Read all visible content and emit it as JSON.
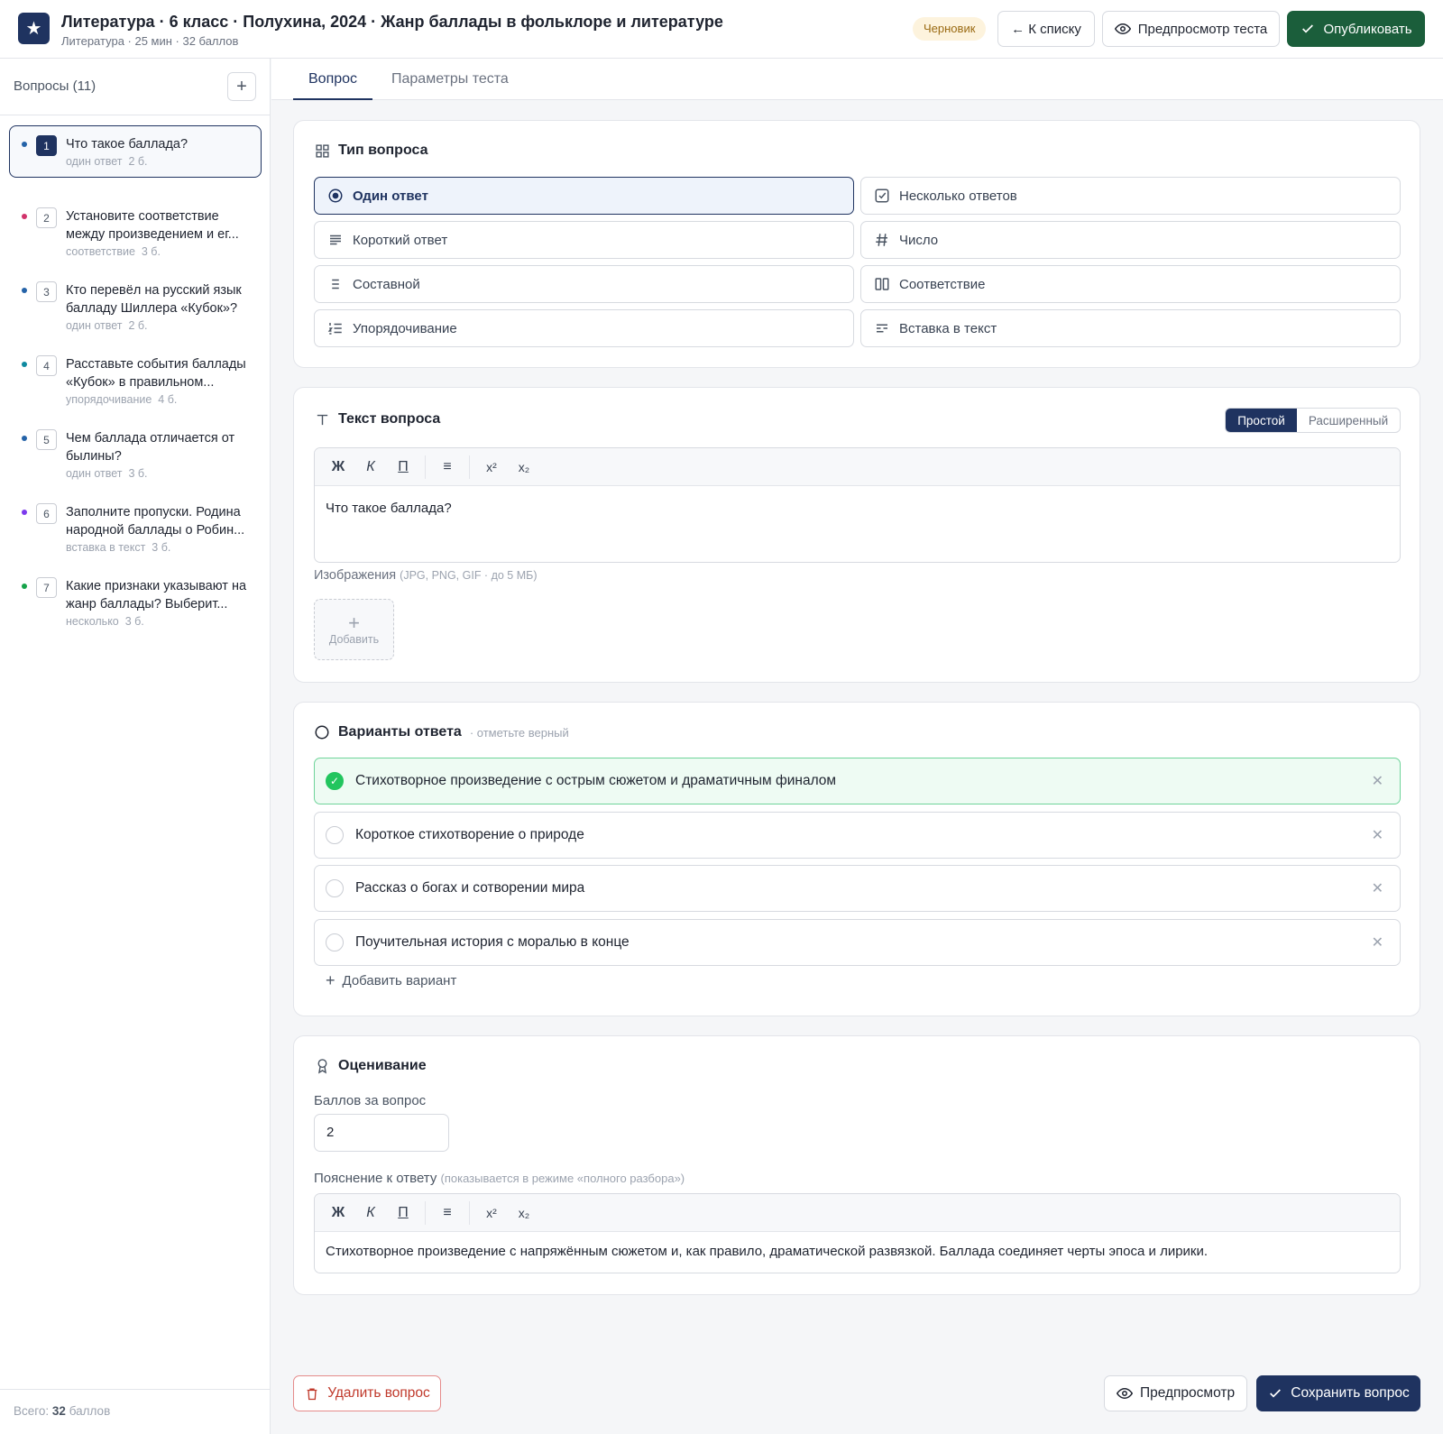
{
  "header": {
    "logo_icon": "star-icon",
    "title": "Литература · 6 класс · Полухина, 2024 · Жанр баллады в фольклоре и литературе",
    "subtitle": "Литература · 25 мин · 32 баллов",
    "status": "Черновик",
    "back_label": "← К списку",
    "preview_test_label": "Предпросмотр теста",
    "publish_label": "Опубликовать"
  },
  "sidebar": {
    "title": "Вопросы (11)",
    "add_label": "+",
    "items": [
      {
        "num": "1",
        "text": "Что такое баллада?",
        "type": "один ответ",
        "points": "2 б.",
        "dot": "#2563a8"
      },
      {
        "num": "2",
        "text": "Установите соответствие между произведением и ег...",
        "type": "соответствие",
        "points": "3 б.",
        "dot": "#d1336b"
      },
      {
        "num": "3",
        "text": "Кто перевёл на русский язык балладу Шиллера «Кубок»?",
        "type": "один ответ",
        "points": "2 б.",
        "dot": "#2563a8"
      },
      {
        "num": "4",
        "text": "Расставьте события баллады «Кубок» в правильном...",
        "type": "упорядочивание",
        "points": "4 б.",
        "dot": "#0e8aa0"
      },
      {
        "num": "5",
        "text": "Чем баллада отличается от былины?",
        "type": "один ответ",
        "points": "3 б.",
        "dot": "#2563a8"
      },
      {
        "num": "6",
        "text": "Заполните пропуски. Родина народной баллады о Робин...",
        "type": "вставка в текст",
        "points": "3 б.",
        "dot": "#7c3aed"
      },
      {
        "num": "7",
        "text": "Какие признаки указывают на жанр баллады? Выберит...",
        "type": "несколько",
        "points": "3 б.",
        "dot": "#16a34a"
      }
    ],
    "footer_prefix": "Всего:",
    "footer_value": "32",
    "footer_suffix": "баллов"
  },
  "tabs": [
    "Вопрос",
    "Параметры теста"
  ],
  "question_type": {
    "title": "Тип вопроса",
    "options": [
      {
        "label": "Один ответ",
        "icon": "radio-target-icon"
      },
      {
        "label": "Несколько ответов",
        "icon": "checkbox-icon"
      },
      {
        "label": "Короткий ответ",
        "icon": "text-lines-icon"
      },
      {
        "label": "Число",
        "icon": "hash-icon"
      },
      {
        "label": "Составной",
        "icon": "list-icon"
      },
      {
        "label": "Соответствие",
        "icon": "columns-icon"
      },
      {
        "label": "Упорядочивание",
        "icon": "ordered-list-icon"
      },
      {
        "label": "Вставка в текст",
        "icon": "text-insert-icon"
      }
    ]
  },
  "question_text": {
    "title": "Текст вопроса",
    "mode_simple": "Простой",
    "mode_extended": "Расширенный",
    "toolbar": [
      "Ж",
      "К",
      "П",
      "≡",
      "x²",
      "x₂"
    ],
    "value": "Что такое баллада?",
    "images_label": "Изображения",
    "images_hint": "(JPG, PNG, GIF · до 5 МБ)",
    "images_add": "Добавить"
  },
  "answers": {
    "title": "Варианты ответа",
    "hint": "· отметьте верный",
    "options": [
      {
        "text": "Стихотворное произведение с острым сюжетом и драматичным финалом",
        "correct": true
      },
      {
        "text": "Короткое стихотворение о природе",
        "correct": false
      },
      {
        "text": "Рассказ о богах и сотворении мира",
        "correct": false
      },
      {
        "text": "Поучительная история с моралью в конце",
        "correct": false
      }
    ],
    "add_label": "Добавить вариант"
  },
  "grading": {
    "title": "Оценивание",
    "points_label": "Баллов за вопрос",
    "points_value": "2",
    "explanation_label": "Пояснение к ответу",
    "explanation_hint": "(показывается в режиме «полного разбора»)",
    "toolbar": [
      "Ж",
      "К",
      "П",
      "≡",
      "x²",
      "x₂"
    ],
    "explanation_value": "Стихотворное произведение с напряжённым сюжетом и, как правило, драматической развязкой. Баллада соединяет черты эпоса и лирики."
  },
  "actions": {
    "delete_label": "Удалить вопрос",
    "preview_label": "Предпросмотр",
    "save_label": "Сохранить вопрос"
  },
  "colors": {
    "brand": "#1f3360",
    "publish": "#1b5e3b",
    "correct": "#22c55e",
    "danger": "#c0392b"
  }
}
